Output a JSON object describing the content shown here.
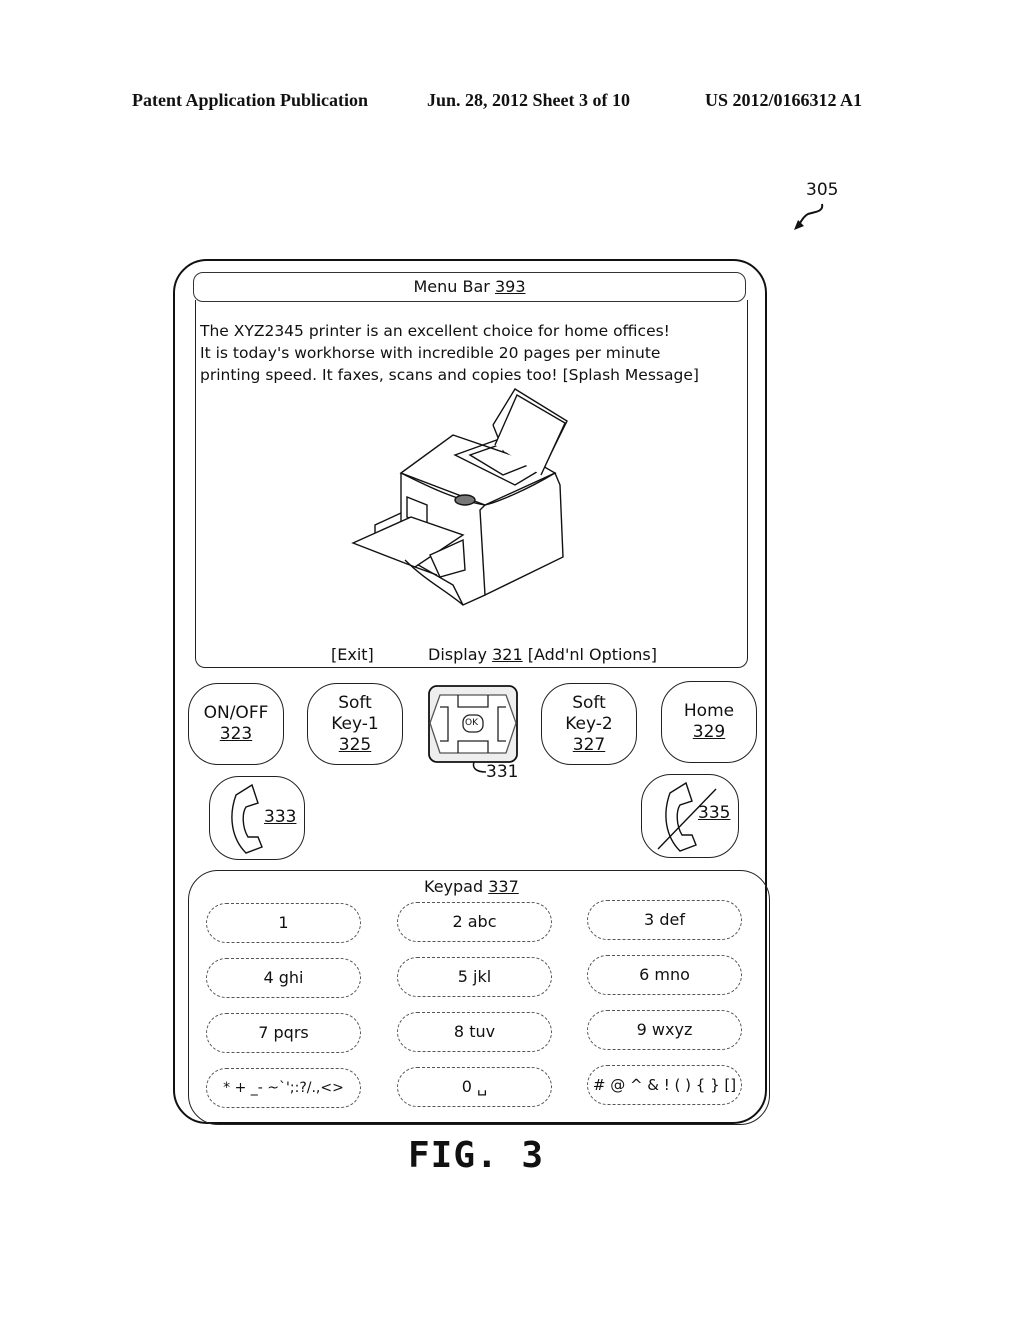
{
  "header": {
    "publication": "Patent Application Publication",
    "date_sheet": "Jun. 28, 2012  Sheet 3 of 10",
    "number": "US 2012/0166312 A1"
  },
  "figure_ref": "305",
  "menu_bar": {
    "label": "Menu Bar",
    "ref": "393"
  },
  "splash": {
    "lines": [
      "The XYZ2345 printer is an excellent choice for home offices!",
      "It is today's workhorse with incredible 20 pages per minute",
      "printing speed. It faxes, scans and copies too! [Splash Message]"
    ]
  },
  "printer_image": "printer-illustration",
  "display": {
    "exit_label": "[Exit]",
    "label": "Display",
    "ref": "321",
    "options_label": "[Add'nl Options]"
  },
  "keys": {
    "on_off": {
      "label": "ON/OFF",
      "ref": "323"
    },
    "soft1": {
      "line1": "Soft",
      "line2": "Key-1",
      "ref": "325"
    },
    "nav": {
      "ok": "OK",
      "ref": "331"
    },
    "soft2": {
      "line1": "Soft",
      "line2": "Key-2",
      "ref": "327"
    },
    "home": {
      "label": "Home",
      "ref": "329"
    },
    "call": {
      "ref": "333",
      "icon": "phone-call-icon"
    },
    "end": {
      "ref": "335",
      "icon": "phone-end-icon"
    }
  },
  "keypad": {
    "label": "Keypad",
    "ref": "337",
    "keys": [
      "1",
      "2 abc",
      "3 def",
      "4 ghi",
      "5 jkl",
      "6 mno",
      "7 pqrs",
      "8 tuv",
      "9 wxyz",
      "* + _- ~`';:?/.,<>",
      "0 ␣",
      "# @ ^ & ! ( ) { } []"
    ]
  },
  "figure_label": "FIG. 3"
}
